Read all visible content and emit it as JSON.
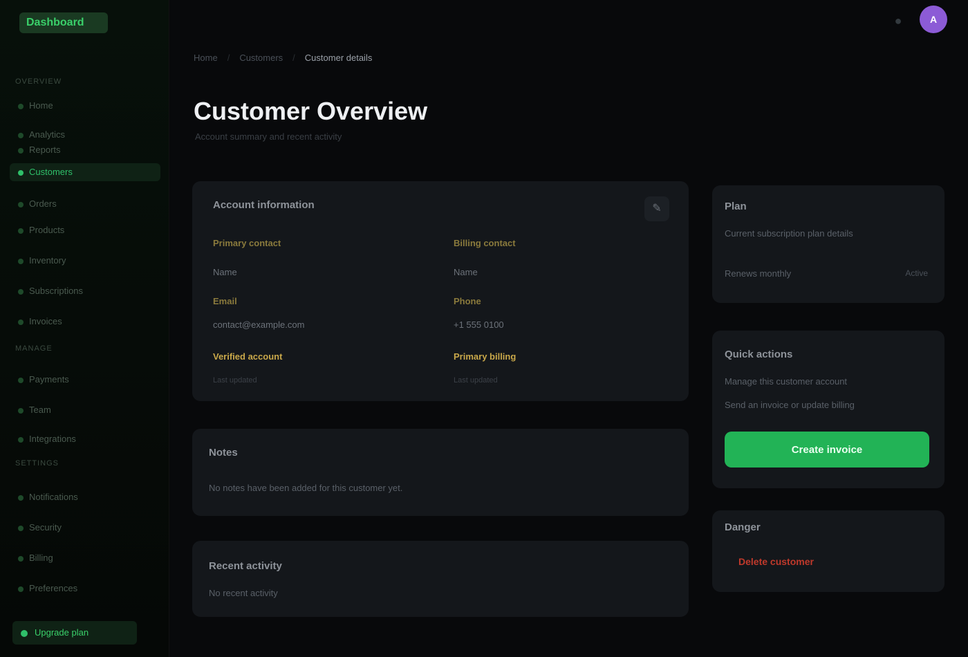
{
  "app": {
    "logo": "Dashboard"
  },
  "sidebar": {
    "sections": [
      {
        "label": "Overview"
      },
      {
        "label": "Manage"
      },
      {
        "label": "Settings"
      }
    ],
    "items": [
      {
        "label": "Home"
      },
      {
        "label": "Analytics"
      },
      {
        "label": "Reports"
      },
      {
        "label": "Customers"
      },
      {
        "label": "Orders"
      },
      {
        "label": "Products"
      },
      {
        "label": "Inventory"
      },
      {
        "label": "Subscriptions"
      },
      {
        "label": "Invoices"
      },
      {
        "label": "Payments"
      },
      {
        "label": "Team"
      },
      {
        "label": "Integrations"
      },
      {
        "label": "Notifications"
      },
      {
        "label": "Security"
      },
      {
        "label": "Billing"
      },
      {
        "label": "Preferences"
      }
    ],
    "footer": {
      "label": "Upgrade plan"
    }
  },
  "topbar": {
    "icon": "bell-icon",
    "avatar_initials": "A"
  },
  "breadcrumb": {
    "items": [
      "Home",
      "Customers",
      "Customer details"
    ]
  },
  "page": {
    "title": "Customer Overview",
    "subtitle": "Account summary and recent activity"
  },
  "details": {
    "title": "Account information",
    "columns": [
      {
        "label": "Primary contact",
        "value": "Name",
        "sub_label": "Email",
        "sub_value": "contact@example.com",
        "highlight": "Verified account",
        "meta": "Last updated"
      },
      {
        "label": "Billing contact",
        "value": "Name",
        "sub_label": "Phone",
        "sub_value": "+1 555 0100",
        "highlight": "Primary billing",
        "meta": "Last updated"
      }
    ]
  },
  "notes": {
    "title": "Notes",
    "text": "No notes have been added for this customer yet."
  },
  "activity": {
    "title": "Recent activity",
    "text": "No recent activity"
  },
  "plan": {
    "title": "Plan",
    "text": "Current subscription plan details",
    "meta": "Renews monthly",
    "badge": "Active"
  },
  "actions": {
    "title": "Quick actions",
    "line1": "Manage this customer account",
    "line2": "Send an invoice or update billing",
    "button_label": "Create invoice"
  },
  "danger": {
    "title": "Danger",
    "link": "Delete customer"
  }
}
